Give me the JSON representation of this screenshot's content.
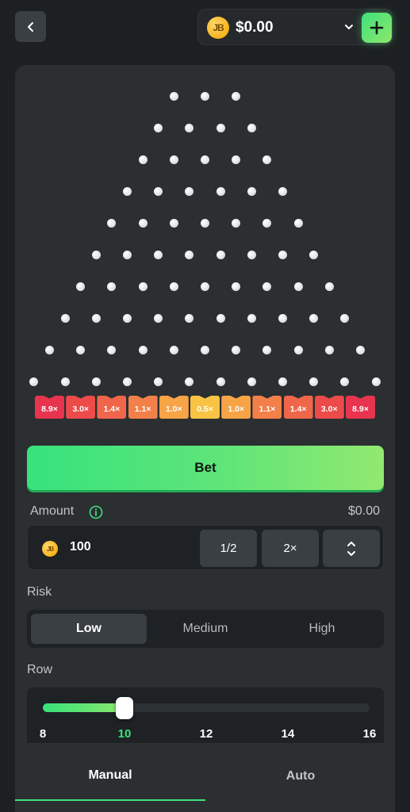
{
  "header": {
    "balance": "$0.00",
    "coin_symbol": "JB"
  },
  "board": {
    "multipliers": [
      "8.9×",
      "3.0×",
      "1.4×",
      "1.1×",
      "1.0×",
      "0.5×",
      "1.0×",
      "1.1×",
      "1.4×",
      "3.0×",
      "8.9×"
    ],
    "slot_colors": [
      "#e8344e",
      "#ed4a4a",
      "#f0664a",
      "#f38049",
      "#f7a446",
      "#f9c443",
      "#f7a446",
      "#f38049",
      "#f0664a",
      "#ed4a4a",
      "#e8344e"
    ]
  },
  "bet_button": {
    "label": "Bet"
  },
  "amount": {
    "label": "Amount",
    "total": "$0.00",
    "value": "100",
    "half_label": "1/2",
    "double_label": "2×"
  },
  "risk": {
    "label": "Risk",
    "options": [
      "Low",
      "Medium",
      "High"
    ],
    "selected": "Low"
  },
  "row": {
    "label": "Row",
    "ticks": [
      "8",
      "10",
      "12",
      "14",
      "16"
    ],
    "min": 8,
    "max": 16,
    "value": 10
  },
  "tabs": {
    "items": [
      "Manual",
      "Auto"
    ],
    "selected": "Manual"
  },
  "colors": {
    "accent": "#3ee07d",
    "background": "#1d2022",
    "card": "#2b2f31"
  }
}
